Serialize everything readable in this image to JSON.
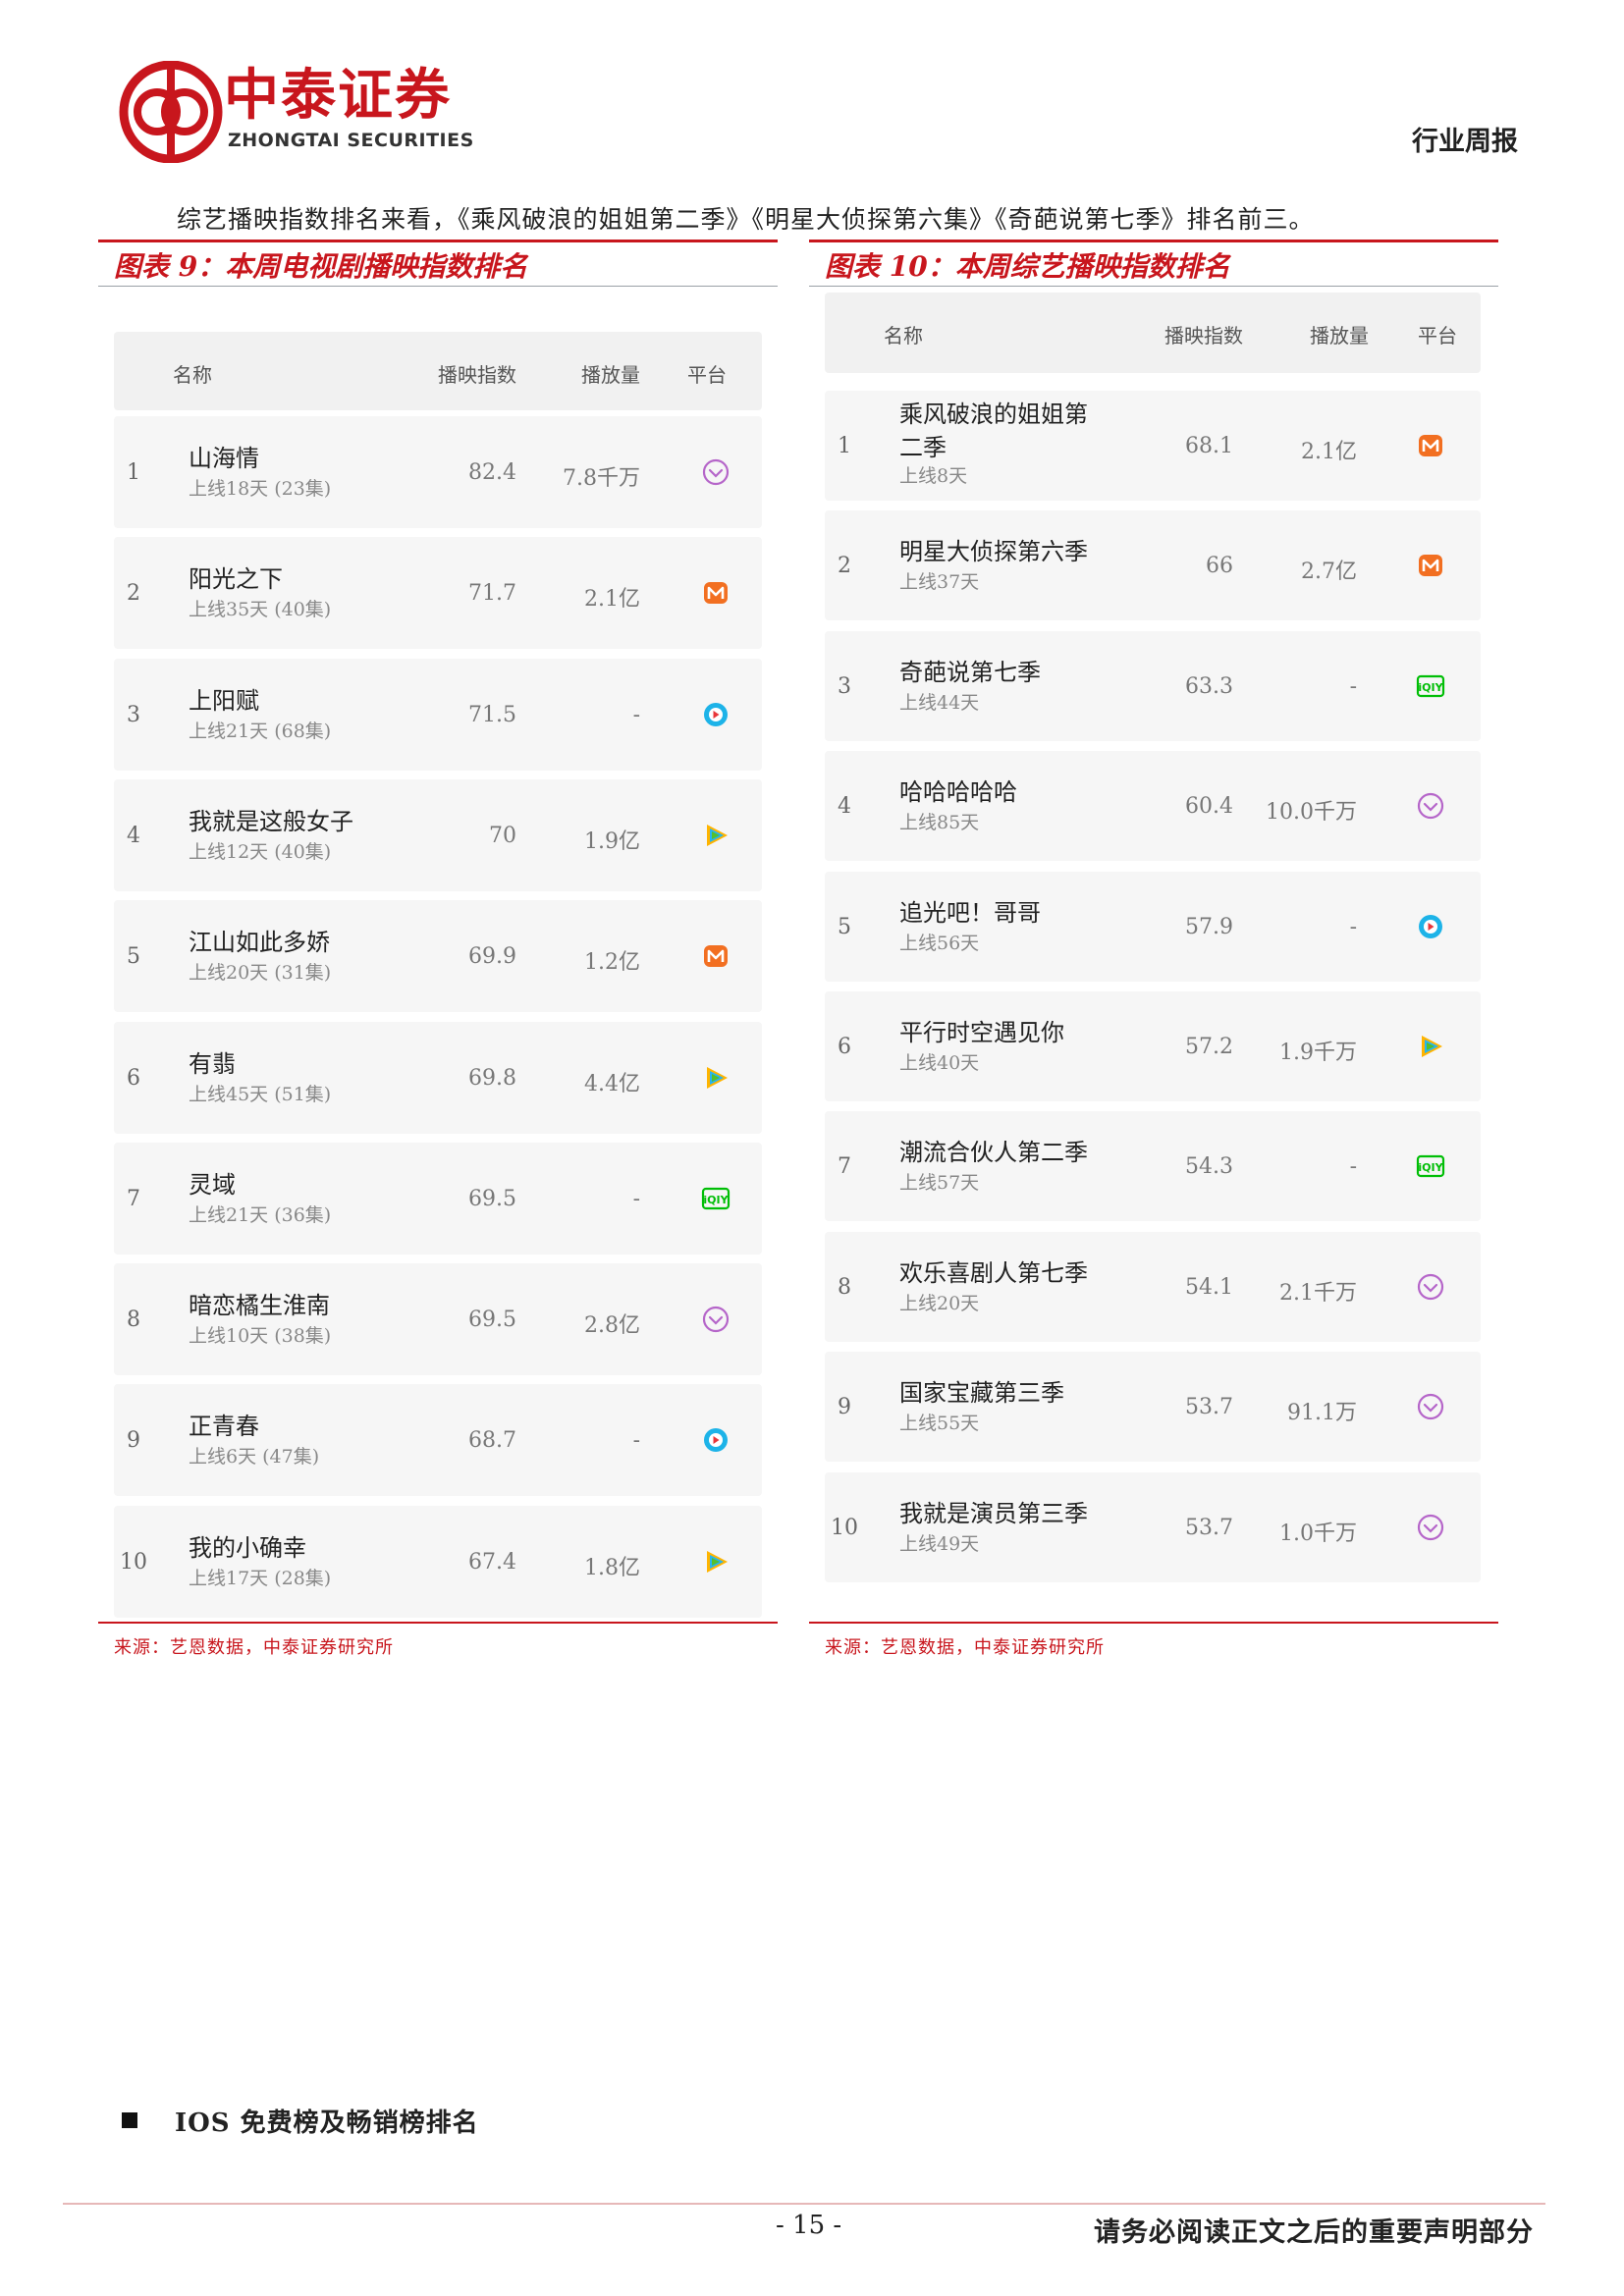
{
  "header": {
    "brand_cn": "中泰证券",
    "brand_en": "ZHONGTAI SECURITIES",
    "report_type": "行业周报",
    "brand_color": "#c8161d"
  },
  "intro": "综艺播映指数排名来看，《乘风破浪的姐姐第二季》《明星大侦探第六集》《奇葩说第七季》排名前三。",
  "tv_table": {
    "title": "图表 9：本周电视剧播映指数排名",
    "headers": [
      "名称",
      "播映指数",
      "播放量",
      "平台"
    ],
    "rows": [
      {
        "rank": "1",
        "name": "山海情",
        "sub": "上线18天 (23集)",
        "index": "82.4",
        "plays": "7.8千万",
        "platform": "youku-icon"
      },
      {
        "rank": "2",
        "name": "阳光之下",
        "sub": "上线35天 (40集)",
        "index": "71.7",
        "plays": "2.1亿",
        "platform": "mgtv-icon"
      },
      {
        "rank": "3",
        "name": "上阳赋",
        "sub": "上线21天 (68集)",
        "index": "71.5",
        "plays": "-",
        "platform": "tencent-icon"
      },
      {
        "rank": "4",
        "name": "我就是这般女子",
        "sub": "上线12天 (40集)",
        "index": "70",
        "plays": "1.9亿",
        "platform": "tencent-video-icon"
      },
      {
        "rank": "5",
        "name": "江山如此多娇",
        "sub": "上线20天 (31集)",
        "index": "69.9",
        "plays": "1.2亿",
        "platform": "mgtv-icon"
      },
      {
        "rank": "6",
        "name": "有翡",
        "sub": "上线45天 (51集)",
        "index": "69.8",
        "plays": "4.4亿",
        "platform": "tencent-video-icon"
      },
      {
        "rank": "7",
        "name": "灵域",
        "sub": "上线21天 (36集)",
        "index": "69.5",
        "plays": "-",
        "platform": "iqiyi-icon"
      },
      {
        "rank": "8",
        "name": "暗恋橘生淮南",
        "sub": "上线10天 (38集)",
        "index": "69.5",
        "plays": "2.8亿",
        "platform": "youku-icon"
      },
      {
        "rank": "9",
        "name": "正青春",
        "sub": "上线6天 (47集)",
        "index": "68.7",
        "plays": "-",
        "platform": "tencent-icon"
      },
      {
        "rank": "10",
        "name": "我的小确幸",
        "sub": "上线17天 (28集)",
        "index": "67.4",
        "plays": "1.8亿",
        "platform": "tencent-video-icon"
      }
    ],
    "source": "来源：艺恩数据，中泰证券研究所"
  },
  "variety_table": {
    "title": "图表 10：本周综艺播映指数排名",
    "headers": [
      "名称",
      "播映指数",
      "播放量",
      "平台"
    ],
    "rows": [
      {
        "rank": "1",
        "name": "乘风破浪的姐姐第",
        "name2": "二季",
        "sub": "上线8天",
        "index": "68.1",
        "plays": "2.1亿",
        "platform": "mgtv-icon"
      },
      {
        "rank": "2",
        "name": "明星大侦探第六季",
        "sub": "上线37天",
        "index": "66",
        "plays": "2.7亿",
        "platform": "mgtv-icon"
      },
      {
        "rank": "3",
        "name": "奇葩说第七季",
        "sub": "上线44天",
        "index": "63.3",
        "plays": "-",
        "platform": "iqiyi-icon"
      },
      {
        "rank": "4",
        "name": "哈哈哈哈哈",
        "sub": "上线85天",
        "index": "60.4",
        "plays": "10.0千万",
        "platform": "youku-icon"
      },
      {
        "rank": "5",
        "name": "追光吧！哥哥",
        "sub": "上线56天",
        "index": "57.9",
        "plays": "-",
        "platform": "tencent-icon"
      },
      {
        "rank": "6",
        "name": "平行时空遇见你",
        "sub": "上线40天",
        "index": "57.2",
        "plays": "1.9千万",
        "platform": "tencent-video-icon"
      },
      {
        "rank": "7",
        "name": "潮流合伙人第二季",
        "sub": "上线57天",
        "index": "54.3",
        "plays": "-",
        "platform": "iqiyi-icon"
      },
      {
        "rank": "8",
        "name": "欢乐喜剧人第七季",
        "sub": "上线20天",
        "index": "54.1",
        "plays": "2.1千万",
        "platform": "youku-icon"
      },
      {
        "rank": "9",
        "name": "国家宝藏第三季",
        "sub": "上线55天",
        "index": "53.7",
        "plays": "91.1万",
        "platform": "youku-icon"
      },
      {
        "rank": "10",
        "name": "我就是演员第三季",
        "sub": "上线49天",
        "index": "53.7",
        "plays": "1.0千万",
        "platform": "youku-icon"
      }
    ],
    "source": "来源：艺恩数据，中泰证券研究所"
  },
  "section": {
    "title": "IOS 免费榜及畅销榜排名"
  },
  "footer": {
    "page": "- 15 -",
    "disclaimer": "请务必阅读正文之后的重要声明部分"
  }
}
